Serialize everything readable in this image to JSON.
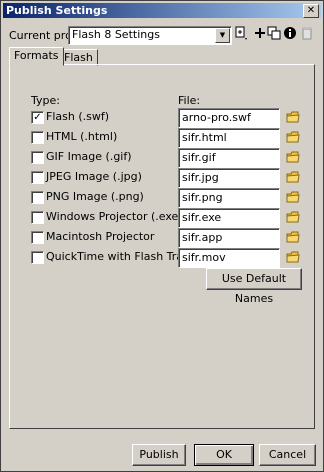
{
  "window": {
    "title": "Publish Settings",
    "close_glyph": "✕"
  },
  "profile": {
    "label": "Current profile:",
    "value": "Flash 8 Settings"
  },
  "toolbar": {
    "icons": [
      "import-export-icon",
      "add-profile-icon",
      "duplicate-profile-icon",
      "profile-info-icon",
      "delete-profile-icon"
    ]
  },
  "tabs": [
    {
      "label": "Formats"
    },
    {
      "label": "Flash"
    }
  ],
  "formats": {
    "type_header": "Type:",
    "file_header": "File:",
    "rows": [
      {
        "label": "Flash  (.swf)",
        "file": "arno-pro.swf",
        "checked": true
      },
      {
        "label": "HTML  (.html)",
        "file": "sifr.html",
        "checked": false
      },
      {
        "label": "GIF Image  (.gif)",
        "file": "sifr.gif",
        "checked": false
      },
      {
        "label": "JPEG Image  (.jpg)",
        "file": "sifr.jpg",
        "checked": false
      },
      {
        "label": "PNG Image  (.png)",
        "file": "sifr.png",
        "checked": false
      },
      {
        "label": "Windows Projector  (.exe)",
        "file": "sifr.exe",
        "checked": false
      },
      {
        "label": "Macintosh Projector",
        "file": "sifr.app",
        "checked": false
      },
      {
        "label": "QuickTime with Flash Track  (.mov)",
        "file": "sifr.mov",
        "checked": false
      }
    ],
    "default_names_label": "Use Default Names"
  },
  "buttons": {
    "publish": "Publish",
    "ok": "OK",
    "cancel": "Cancel"
  },
  "colors": {
    "titlebar_start": "#0a246a",
    "titlebar_end": "#a6caf0",
    "face": "#d4d0c8",
    "folder": "#f0c040"
  }
}
